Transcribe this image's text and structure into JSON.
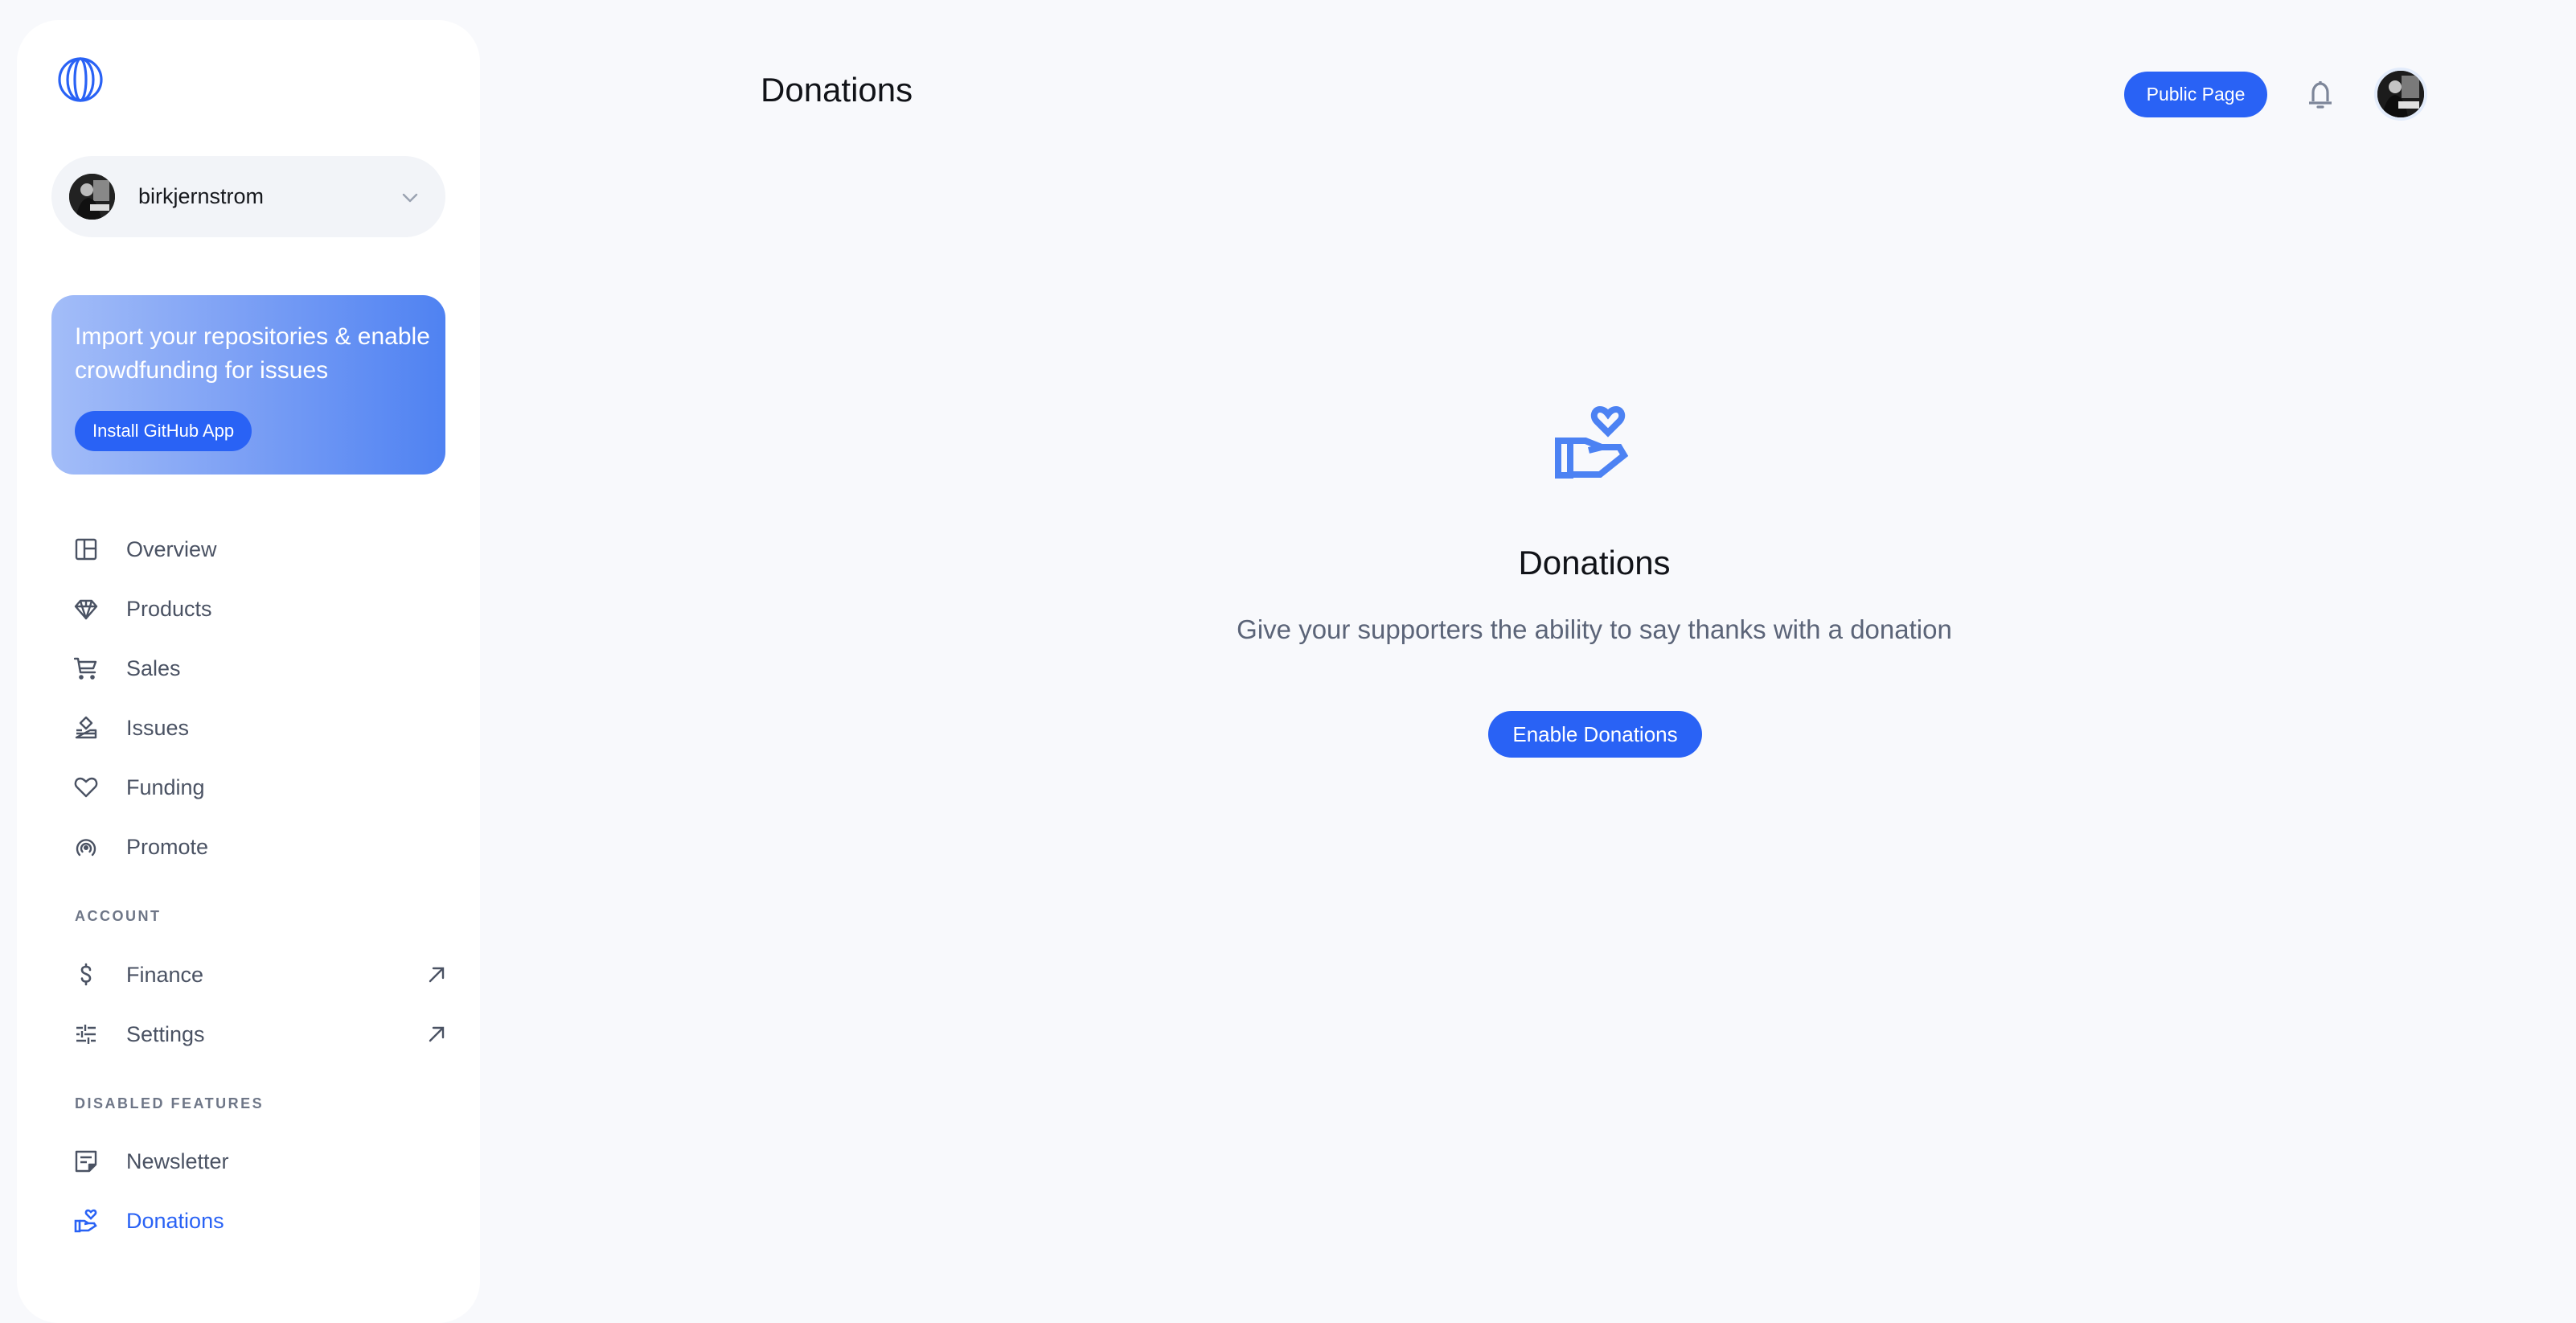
{
  "app": {
    "logo_icon": "polar-globe-logo"
  },
  "account": {
    "username": "birkjernstrom",
    "avatar_icon": "user-avatar",
    "dropdown_icon": "chevron-down-icon"
  },
  "promo": {
    "text": "Import your repositories & enable crowdfunding for issues",
    "button_label": "Install GitHub App"
  },
  "sidebar": {
    "main_items": [
      {
        "label": "Overview",
        "icon": "layout-dashboard-icon"
      },
      {
        "label": "Products",
        "icon": "diamond-icon"
      },
      {
        "label": "Sales",
        "icon": "shopping-cart-icon"
      },
      {
        "label": "Issues",
        "icon": "stamp-icon"
      },
      {
        "label": "Funding",
        "icon": "heart-icon"
      },
      {
        "label": "Promote",
        "icon": "broadcast-icon"
      }
    ],
    "account_section_label": "ACCOUNT",
    "account_items": [
      {
        "label": "Finance",
        "icon": "dollar-icon",
        "external": true
      },
      {
        "label": "Settings",
        "icon": "sliders-icon",
        "external": true
      }
    ],
    "disabled_section_label": "DISABLED FEATURES",
    "disabled_items": [
      {
        "label": "Newsletter",
        "icon": "note-icon"
      },
      {
        "label": "Donations",
        "icon": "hand-heart-icon",
        "active": true
      }
    ]
  },
  "header": {
    "title": "Donations",
    "public_page_label": "Public Page",
    "notifications_icon": "bell-icon"
  },
  "empty_state": {
    "icon": "hand-heart-icon",
    "title": "Donations",
    "subtitle": "Give your supporters the ability to say thanks with a donation",
    "button_label": "Enable Donations"
  },
  "colors": {
    "accent": "#2962F5",
    "page_background": "#F8F9FC",
    "sidebar_background": "#FFFFFF",
    "nav_text": "#4A5263",
    "muted_text": "#5B6478"
  }
}
